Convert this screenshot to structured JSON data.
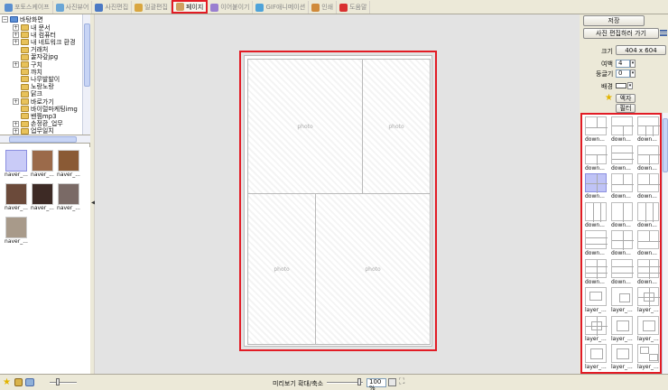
{
  "tabs": [
    {
      "label": "포토스케이프",
      "color": "#5a8fd0",
      "active": false
    },
    {
      "label": "사진뷰어",
      "color": "#6aa6d6",
      "active": false
    },
    {
      "label": "사진편집",
      "color": "#4b79c4",
      "active": false
    },
    {
      "label": "일괄편집",
      "color": "#d9a640",
      "active": false
    },
    {
      "label": "페이지",
      "color": "#cfa060",
      "active": true
    },
    {
      "label": "이어붙이기",
      "color": "#9a7fd0",
      "active": false
    },
    {
      "label": "GIF애니메이션",
      "color": "#4fa3d9",
      "active": false
    },
    {
      "label": "인쇄",
      "color": "#d08a3a",
      "active": false
    },
    {
      "label": "도움말",
      "color": "#d93030",
      "active": false
    }
  ],
  "tree": {
    "root": "바탕화면",
    "items": [
      {
        "label": "내 문서",
        "expander": "+"
      },
      {
        "label": "내 컴퓨터",
        "expander": "+"
      },
      {
        "label": "내 네트워크 환경",
        "expander": "+"
      },
      {
        "label": "거래처",
        "expander": ""
      },
      {
        "label": "꿀쟈갚jpg",
        "expander": ""
      },
      {
        "label": "구치",
        "expander": "+"
      },
      {
        "label": "꺄치",
        "expander": ""
      },
      {
        "label": "나무발발이",
        "expander": ""
      },
      {
        "label": "노랑노랑",
        "expander": ""
      },
      {
        "label": "닭크",
        "expander": ""
      },
      {
        "label": "바로가기",
        "expander": "+"
      },
      {
        "label": "바이럴마케팅img",
        "expander": ""
      },
      {
        "label": "밴찜mp3",
        "expander": ""
      },
      {
        "label": "손정환_업무",
        "expander": "+"
      },
      {
        "label": "업무일지",
        "expander": "+"
      }
    ]
  },
  "thumbnails": [
    {
      "caption": "naver_...",
      "color": "#c9cbf7",
      "selected": true
    },
    {
      "caption": "naver_...",
      "color": "#9b6a4a",
      "selected": false
    },
    {
      "caption": "naver_...",
      "color": "#8a5a35",
      "selected": false
    },
    {
      "caption": "naver_...",
      "color": "#6b4a3a",
      "selected": false
    },
    {
      "caption": "naver_...",
      "color": "#3d2a25",
      "selected": false
    },
    {
      "caption": "naver_...",
      "color": "#7a6a66",
      "selected": false
    },
    {
      "caption": "naver_...",
      "color": "#a89a8a",
      "selected": false
    }
  ],
  "canvas": {
    "cells": [
      {
        "label": "photo"
      },
      {
        "label": "photo"
      },
      {
        "label": "photo"
      },
      {
        "label": "photo"
      }
    ]
  },
  "panel": {
    "save_label": "저장",
    "edit_label": "사진 편집하러 가기",
    "size_label": "크기",
    "size_value": "404 x 604",
    "margin_label": "여백",
    "margin_value": "4",
    "round_label": "둥글기",
    "round_value": "0",
    "bg_label": "배경",
    "frame_label": "액자",
    "filter_label": "필터"
  },
  "templates": [
    {
      "caption": "down...",
      "icon": "two-top-one-bottom"
    },
    {
      "caption": "down...",
      "icon": "one-top-two-bottom"
    },
    {
      "caption": "down...",
      "icon": "one-top-three-bottom"
    },
    {
      "caption": "down...",
      "icon": "one-top-two-bottom"
    },
    {
      "caption": "down...",
      "icon": "three-rows"
    },
    {
      "caption": "down...",
      "icon": "one-top-two-bottom"
    },
    {
      "caption": "down...",
      "icon": "four-grid",
      "selected": true
    },
    {
      "caption": "down...",
      "icon": "two-top-one-bottom"
    },
    {
      "caption": "down...",
      "icon": "two-top-one-bottom"
    },
    {
      "caption": "down...",
      "icon": "three-cols"
    },
    {
      "caption": "down...",
      "icon": "two-cols"
    },
    {
      "caption": "down...",
      "icon": "three-cols"
    },
    {
      "caption": "down...",
      "icon": "three-rows"
    },
    {
      "caption": "down...",
      "icon": "four-grid"
    },
    {
      "caption": "down...",
      "icon": "two-top-one-bottom"
    },
    {
      "caption": "down...",
      "icon": "six-grid"
    },
    {
      "caption": "down...",
      "icon": "three-rows"
    },
    {
      "caption": "down...",
      "icon": "six-grid"
    },
    {
      "caption": "layer_...",
      "icon": "layer-a"
    },
    {
      "caption": "layer_...",
      "icon": "layer-b"
    },
    {
      "caption": "layer_...",
      "icon": "layer-cross"
    },
    {
      "caption": "layer_...",
      "icon": "layer-cross"
    },
    {
      "caption": "layer_...",
      "icon": "layer-inset"
    },
    {
      "caption": "layer_...",
      "icon": "layer-inset"
    },
    {
      "caption": "layer_...",
      "icon": "layer-inset"
    },
    {
      "caption": "layer_...",
      "icon": "layer-inset"
    },
    {
      "caption": "layer_...",
      "icon": "layer-corner"
    },
    {
      "caption": "layer_...",
      "icon": "layer-tall"
    },
    {
      "caption": "layer_...",
      "icon": "four-grid"
    },
    {
      "caption": "layer_...",
      "icon": "four-grid"
    }
  ],
  "statusbar": {
    "preview_label": "미리보기 확대/축소",
    "zoom_value": "100 %"
  }
}
